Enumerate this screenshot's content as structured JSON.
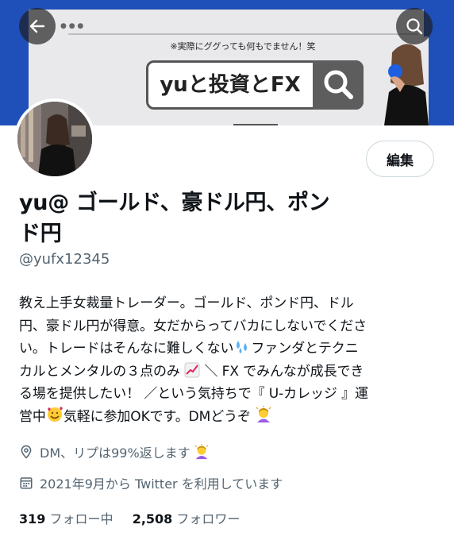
{
  "banner": {
    "tagline": "※実際にググっても何もでません！笑",
    "search_query": "yuと投資とFX"
  },
  "header": {
    "back_icon": "arrow-left-icon",
    "search_icon": "search-icon"
  },
  "profile": {
    "edit_label": "編集",
    "name_line1": "yu@ ゴールド、豪ドル円、ポン",
    "name_line2": "ド円",
    "handle": "@yufx12345",
    "bio_lines": [
      "教え上手女裁量トレーダー。ゴールド、ポンド円、ドル",
      "円、豪ドル円が得意。女だからってバカにしないでくださ",
      "い。トレードはそんなに難しくない",
      "ファンダとテクニ",
      "カルとメンタルの３点のみ",
      "＼ FX でみんなが成長でき",
      "る場を提供したい！ ／という気持ちで『 U-カレッジ 』運",
      "営中",
      "気軽に参加OKです。DMどうぞ"
    ],
    "location": "DM、リプは99%返します",
    "joined": "2021年9月から Twitter を利用しています",
    "following_count": "319",
    "following_label": "フォロー中",
    "followers_count": "2,508",
    "followers_label": "フォロワー"
  },
  "colors": {
    "banner_blue": "#1f4fb8",
    "text_primary": "#0f1419",
    "text_secondary": "#536471",
    "border": "#cfd9de"
  }
}
